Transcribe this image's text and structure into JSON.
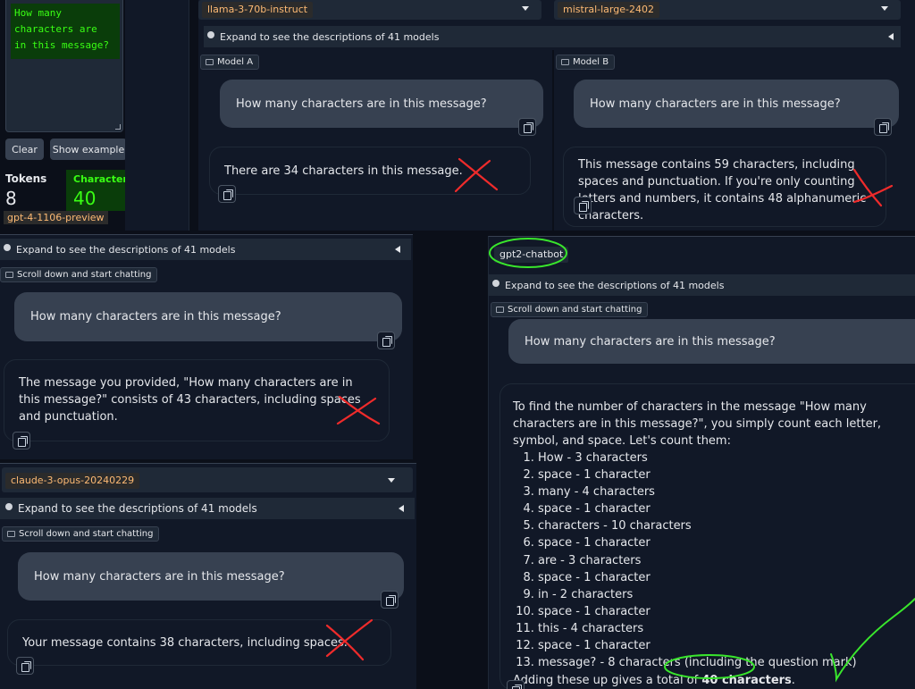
{
  "tokenizer": {
    "textarea_value": "How many\ncharacters are\nin this message?",
    "clear_label": "Clear",
    "show_example_label": "Show example",
    "tokens_label": "Tokens",
    "tokens_value": "8",
    "characters_label": "Characters",
    "characters_value": "40",
    "model_tag": "gpt-4-1106-preview"
  },
  "top_arena": {
    "model_a": "llama-3-70b-instruct",
    "model_b": "mistral-large-2402",
    "expand_text": "Expand to see the descriptions of 41 models",
    "label_a": "Model A",
    "label_b": "Model B",
    "user_message_a": "How many characters are in this message?",
    "user_message_b": "How many characters are in this message?",
    "reply_a": "There are 34 characters in this message.",
    "reply_b": "This message contains 59 characters, including spaces and punctuation. If you're only counting letters and numbers, it contains 48 alphanumeric characters."
  },
  "left_mid": {
    "expand_text": "Expand to see the descriptions of 41 models",
    "scroll_label": "Scroll down and start chatting",
    "user_message": "How many characters are in this message?",
    "reply": "The message you provided, \"How many characters are in this message?\" consists of 43 characters, including spaces and punctuation."
  },
  "left_bottom": {
    "model": "claude-3-opus-20240229",
    "expand_text": "Expand to see the descriptions of 41 models",
    "scroll_label": "Scroll down and start chatting",
    "user_message": "How many characters are in this message?",
    "reply": "Your message contains 38 characters, including spaces."
  },
  "right": {
    "model": "gpt2-chatbot",
    "expand_text": "Expand to see the descriptions of 41 models",
    "scroll_label": "Scroll down and start chatting",
    "user_message": "How many characters are in this message?",
    "reply_intro": "To find the number of characters in the message \"How many characters are in this message?\", you simply count each letter, symbol, and space. Let's count them:",
    "steps": [
      "How - 3 characters",
      "space - 1 character",
      "many - 4 characters",
      "space - 1 character",
      "characters - 10 characters",
      "space - 1 character",
      "are - 3 characters",
      "space - 1 character",
      "in - 2 characters",
      "space - 1 character",
      "this - 4 characters",
      "space - 1 character",
      "message? - 8 characters (including the question mark)"
    ],
    "conclusion_prefix": "Adding these up gives a total of ",
    "conclusion_bold": "40 characters",
    "conclusion_suffix": "."
  },
  "colors": {
    "background": "#0b0f19",
    "panel": "#111827",
    "user_bubble": "#374151",
    "model_tag_text": "#fdba74",
    "tokenizer_green": "#22c55e",
    "red_mark": "#ef2b2b",
    "green_mark": "#39e62c"
  }
}
